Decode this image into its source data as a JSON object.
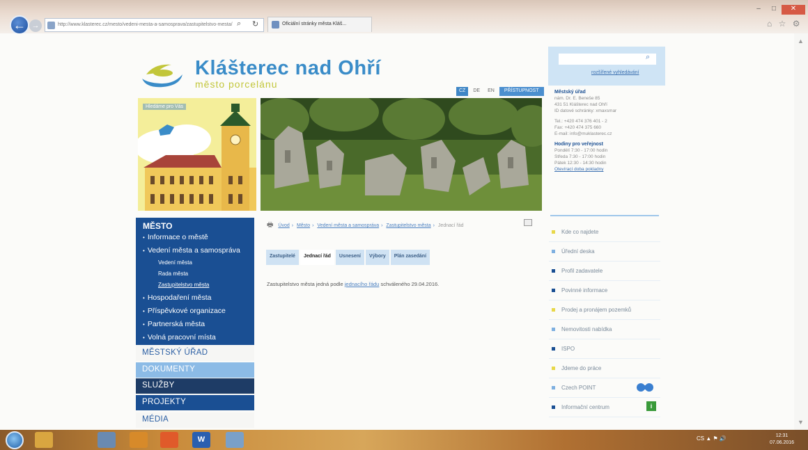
{
  "browser": {
    "address": "http://www.klasterec.cz/mesto/vedeni-mesta-a-samosprava/zastupitelstvo-mesta/",
    "tab_title": "Oficiální stránky města Kláš...",
    "back_glyph": "←",
    "fwd_glyph": "→",
    "search_glyph": "⌕",
    "refresh_glyph": "↻",
    "win_min": "–",
    "win_max": "□",
    "win_close": "✕",
    "home_glyph": "⌂",
    "star_glyph": "☆",
    "gear_glyph": "⚙"
  },
  "site": {
    "title": "Klášterec nad Ohří",
    "subtitle": "město porcelánu",
    "colors": {
      "primary": "#1a4f93",
      "accent": "#3a8cc8",
      "yellow": "#c2c63a"
    }
  },
  "lang": {
    "cz": "CZ",
    "de": "DE",
    "en": "EN",
    "access": "PŘÍSTUPNOST"
  },
  "left_image": {
    "label": "Hledáme pro Vás"
  },
  "nav": {
    "head": "MĚSTO",
    "items": [
      {
        "label": "Informace o městě"
      },
      {
        "label": "Vedení města a samospráva"
      },
      {
        "label": "Hospodaření města"
      },
      {
        "label": "Příspěvkové organizace"
      },
      {
        "label": "Partnerská města"
      },
      {
        "label": "Volná pracovní místa"
      }
    ],
    "subitems": [
      {
        "label": "Vedení města"
      },
      {
        "label": "Rada města"
      },
      {
        "label": "Zastupitelstvo města"
      }
    ],
    "sections": {
      "urad": "MĚSTSKÝ ÚŘAD",
      "dokumenty": "DOKUMENTY",
      "sluzby": "SLUŽBY",
      "projekty": "PROJEKTY",
      "media": "MÉDIA"
    }
  },
  "breadcrumb": {
    "print_glyph": "🖶",
    "sep": "›",
    "items": [
      "Úvod",
      "Město",
      "Vedení města a samospráva",
      "Zastupitelstvo města"
    ],
    "current": "Jednací řád"
  },
  "tabs": [
    "Zastupitelé",
    "Jednací řád",
    "Usnesení",
    "Výbory",
    "Plán zasedání"
  ],
  "content": {
    "before": "Zastupitelstvo města jedná podle ",
    "link": "jednacího řádu",
    "after": " schváleného 29.04.2016."
  },
  "sidebar": {
    "search_placeholder": "",
    "search_glyph": "⌕",
    "adv_search": "rozšířené vyhledávání",
    "office": {
      "head": "Městský úřad",
      "lines": [
        "nám. Dr. E. Beneše 85",
        "431 51 Klášterec nad Ohří",
        "ID datové schránky: xmaxsmar"
      ],
      "phone": "Tel.: +420 474 376 401 - 2",
      "fax": "Fax: +420 474 375 660",
      "email": "E-mail: info@muklasterec.cz",
      "hours_head": "Hodiny pro veřejnost",
      "hours": [
        "Pondělí 7:30 - 17:00 hodin",
        "Středa 7:30 - 17:00 hodin",
        "Pátek 12:30 - 14:30 hodin"
      ],
      "hours_link": "Otevírací doba pokladny"
    },
    "links": [
      {
        "label": "Kde co najdete",
        "color": "#e8d84a"
      },
      {
        "label": "Úřední deska",
        "color": "#7fb0e0"
      },
      {
        "label": "Profil zadavatele",
        "color": "#1a4f93"
      },
      {
        "label": "Povinné informace",
        "color": "#1a4f93"
      },
      {
        "label": "Prodej a pronájem pozemků",
        "color": "#e8d84a"
      },
      {
        "label": "Nemovitosti nabídka",
        "color": "#7fb0e0"
      },
      {
        "label": "ISPO",
        "color": "#1a4f93"
      },
      {
        "label": "Jdeme do práce",
        "color": "#e8d84a"
      },
      {
        "label": "Czech POINT",
        "color": "#7fb0e0"
      },
      {
        "label": "Informační centrum",
        "color": "#1a4f93"
      }
    ],
    "info_glyph": "i"
  },
  "taskbar": {
    "apps": [
      {
        "glyph": "",
        "color": "#d9a640"
      },
      {
        "glyph": "",
        "color": "#6a8ab0"
      },
      {
        "glyph": "",
        "color": "#d78a2a"
      },
      {
        "glyph": "",
        "color": "#e05a2a"
      },
      {
        "glyph": "W",
        "color": "#2a5fb0"
      },
      {
        "glyph": "",
        "color": "#7aa0c8"
      }
    ],
    "tray": "CS ▲ ⚑ 🔊",
    "time": "12:31",
    "date": "07.06.2016"
  }
}
